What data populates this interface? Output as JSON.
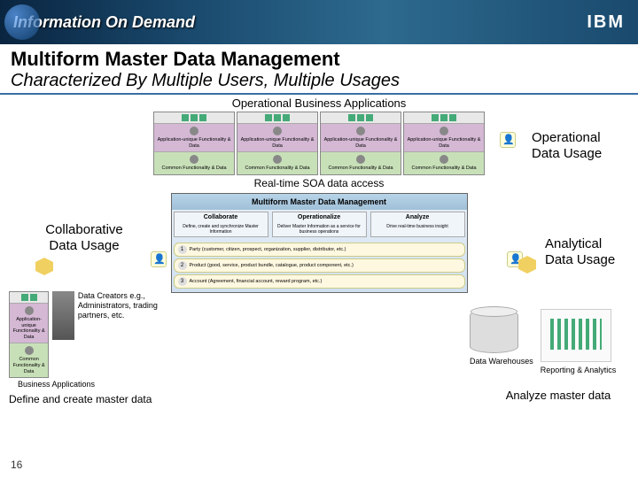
{
  "banner": {
    "title": "Information On Demand",
    "logo": "IBM"
  },
  "heading": {
    "main": "Multiform Master Data Management",
    "sub": "Characterized By Multiple Users, Multiple Usages"
  },
  "labels": {
    "top_section": "Operational Business Applications",
    "operational": "Operational Data Usage",
    "collaborative": "Collaborative Data Usage",
    "analytical": "Analytical Data Usage",
    "soa": "Real-time SOA data access",
    "define": "Define and create master data",
    "analyze": "Analyze master data",
    "data_warehouses": "Data Warehouses",
    "reporting": "Reporting & Analytics",
    "business_apps": "Business Applications",
    "data_creators": "Data Creators e.g., Administrators, trading partners, etc."
  },
  "app_cells": {
    "unique": "Application-unique Functionality & Data",
    "common": "Common Functionality & Data"
  },
  "mdm": {
    "title": "Multiform Master Data Management",
    "cols": [
      {
        "h": "Collaborate",
        "d": "Define, create and synchronize Master Information"
      },
      {
        "h": "Operationalize",
        "d": "Deliver Master Information as a service for business operations"
      },
      {
        "h": "Analyze",
        "d": "Drive real-time business insight"
      }
    ],
    "rows": [
      "Party (customer, citizen, prospect, organization, supplier, distributor, etc.)",
      "Product (good, service, product bundle, catalogue, product component, etc.)",
      "Account (Agreement, financial account, reward program, etc.)"
    ]
  },
  "page": "16"
}
